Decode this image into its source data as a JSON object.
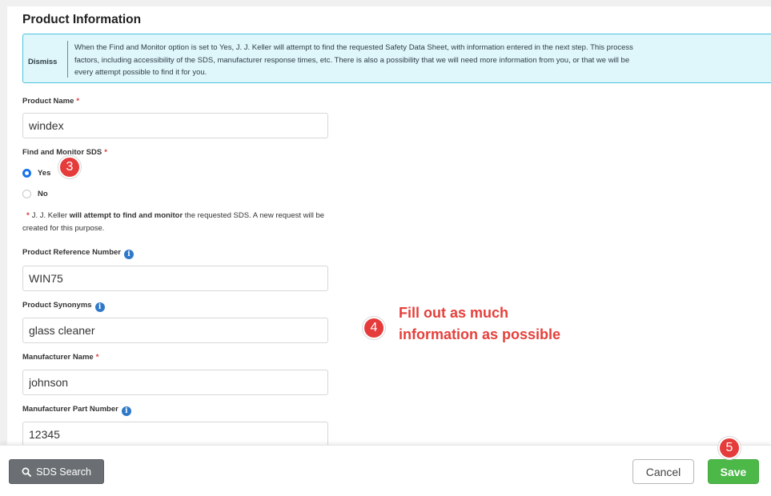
{
  "section": {
    "title": "Product Information"
  },
  "notice": {
    "dismiss_label": "Dismiss",
    "text": "When the Find and Monitor option is set to Yes, J. J. Keller will attempt to find the requested Safety Data Sheet, with information entered in the next step. This process\nfactors, including accessibility of the SDS, manufacturer response times, etc. There is also a possibility that we will need more information from you, or that we will be\nevery attempt possible to find it for you."
  },
  "required_marker": "*",
  "info_glyph": "i",
  "fields": {
    "product_name": {
      "label": "Product Name",
      "value": "windex"
    },
    "find_monitor": {
      "label": "Find and Monitor SDS",
      "options": [
        "Yes",
        "No"
      ],
      "selected": "Yes"
    },
    "monitor_note": {
      "prefix": "J. J. Keller ",
      "bold": "will attempt to find and monitor",
      "suffix": " the requested SDS. A new request will be created for this purpose."
    },
    "product_reference_number": {
      "label": "Product Reference Number",
      "value": "WIN75"
    },
    "product_synonyms": {
      "label": "Product Synonyms",
      "value": "glass cleaner"
    },
    "manufacturer_name": {
      "label": "Manufacturer Name",
      "value": "johnson"
    },
    "manufacturer_part_number": {
      "label": "Manufacturer Part Number",
      "value": "12345"
    }
  },
  "annotations": {
    "step3": "3",
    "step4": "4",
    "step5": "5",
    "step4_text": "Fill out as much\ninformation as possible"
  },
  "footer": {
    "sds_search_label": "SDS Search",
    "cancel_label": "Cancel",
    "save_label": "Save"
  },
  "colors": {
    "accent_blue": "#1a73e8",
    "info_blue": "#2f79c9",
    "notice_bg": "#dff6fb",
    "notice_border": "#4cc3dd",
    "annotation_red": "#e53b3b",
    "save_green": "#4cb848",
    "sds_gray": "#6b6f73"
  },
  "icons": {
    "sds_search": "search-icon",
    "info": "info-icon"
  }
}
